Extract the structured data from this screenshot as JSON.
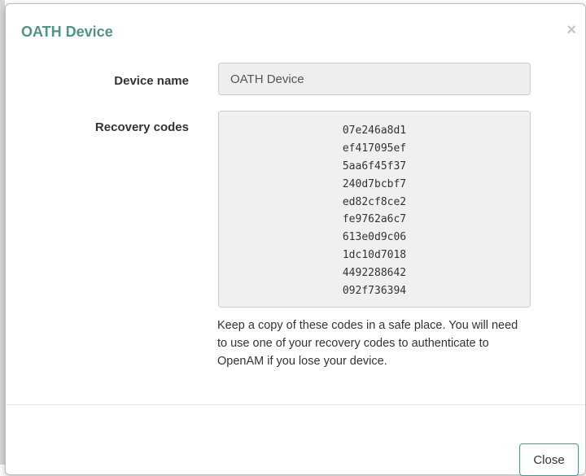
{
  "dialog": {
    "title": "OATH Device",
    "close_icon": "×"
  },
  "form": {
    "device_name_label": "Device name",
    "device_name_value": "OATH Device",
    "recovery_codes_label": "Recovery codes",
    "recovery_codes": [
      "07e246a8d1",
      "ef417095ef",
      "5aa6f45f37",
      "240d7bcbf7",
      "ed82cf8ce2",
      "fe9762a6c7",
      "613e0d9c06",
      "1dc10d7018",
      "4492288642",
      "092f736394"
    ],
    "help_text": "Keep a copy of these codes in a safe place. You will need to use one of your recovery codes to authenticate to OpenAM if you lose your device."
  },
  "footer": {
    "close_label": "Close"
  },
  "colors": {
    "title": "#519387",
    "accent_border": "#519387"
  }
}
